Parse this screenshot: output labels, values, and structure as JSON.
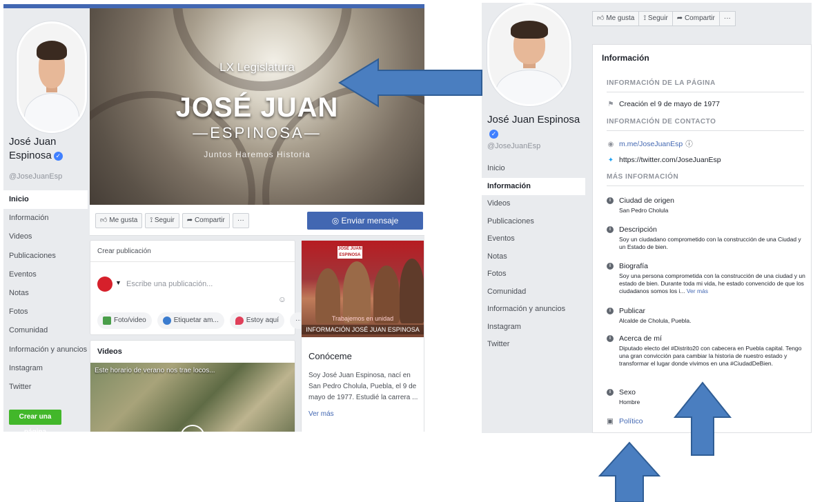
{
  "left": {
    "name": "José Juan Espinosa",
    "handle": "@JoseJuanEsp",
    "nav": [
      "Inicio",
      "Información",
      "Videos",
      "Publicaciones",
      "Eventos",
      "Notas",
      "Fotos",
      "Comunidad",
      "Información y anuncios",
      "Instagram",
      "Twitter"
    ],
    "create_page": "Crear una página",
    "cover": {
      "line1": "LX Legislatura",
      "line2": "JOSÉ JUAN",
      "line3": "—ESPINOSA—",
      "line4": "Juntos Haremos Historia"
    },
    "actions": {
      "like": "Me gusta",
      "follow": "Seguir",
      "share": "Compartir",
      "more": "···",
      "send": "Enviar mensaje"
    },
    "composer": {
      "title": "Crear publicación",
      "placeholder": "Escribe una publicación...",
      "photo": "Foto/video",
      "tag": "Etiquetar am...",
      "here": "Estoy aquí",
      "more": "···"
    },
    "videos": {
      "title": "Videos",
      "caption": "Este horario de verano nos trae locos..."
    },
    "promo": {
      "logo": "JOSÉ JUAN ESPINOSA",
      "cap1": "Trabajemos en unidad",
      "cap2": "INFORMACIÓN JOSÉ JUAN ESPINOSA",
      "heading": "Conóceme",
      "text": "Soy José Juan Espinosa, nací en San Pedro Cholula, Puebla, el 9 de mayo de 1977. Estudié la carrera ...",
      "more": "Ver más"
    }
  },
  "right": {
    "name": "José Juan Espinosa",
    "handle": "@JoseJuanEsp",
    "nav": [
      "Inicio",
      "Información",
      "Videos",
      "Publicaciones",
      "Eventos",
      "Notas",
      "Fotos",
      "Comunidad",
      "Información y anuncios",
      "Instagram",
      "Twitter"
    ],
    "actions": {
      "like": "Me gusta",
      "follow": "Seguir",
      "share": "Compartir",
      "more": "···"
    },
    "info": {
      "title": "Información",
      "page_info": "INFORMACIÓN DE LA PÁGINA",
      "created": "Creación el 9 de mayo de 1977",
      "contact_info": "INFORMACIÓN DE CONTACTO",
      "messenger": "m.me/JoseJuanEsp",
      "twitter": "https://twitter.com/JoseJuanEsp",
      "more_info": "MÁS INFORMACIÓN",
      "origin_h": "Ciudad de origen",
      "origin_t": "San Pedro Cholula",
      "desc_h": "Descripción",
      "desc_t": "Soy un ciudadano comprometido con la construcción de una Ciudad y un Estado de bien.",
      "bio_h": "Biografía",
      "bio_t": "Soy una persona comprometida con la construcción de una ciudad y un estado de bien. Durante toda mi vida, he estado convencido de que los ciudadanos somos los i...",
      "bio_more": "Ver más",
      "pub_h": "Publicar",
      "pub_t": "Alcalde de Cholula, Puebla.",
      "about_h": "Acerca de mí",
      "about_t": "Diputado electo del #Distrito20 con cabecera en Puebla capital. Tengo una gran convicción para cambiar la historia de nuestro estado y transformar el lugar donde vivimos en una #CiudadDeBien.",
      "sex_h": "Sexo",
      "sex_t": "Hombre",
      "category": "Político"
    }
  },
  "colors": {
    "brand": "#4267b2",
    "arrow": "#4a7ec0",
    "arrow_stroke": "#2f5d95",
    "green": "#42b72a"
  }
}
